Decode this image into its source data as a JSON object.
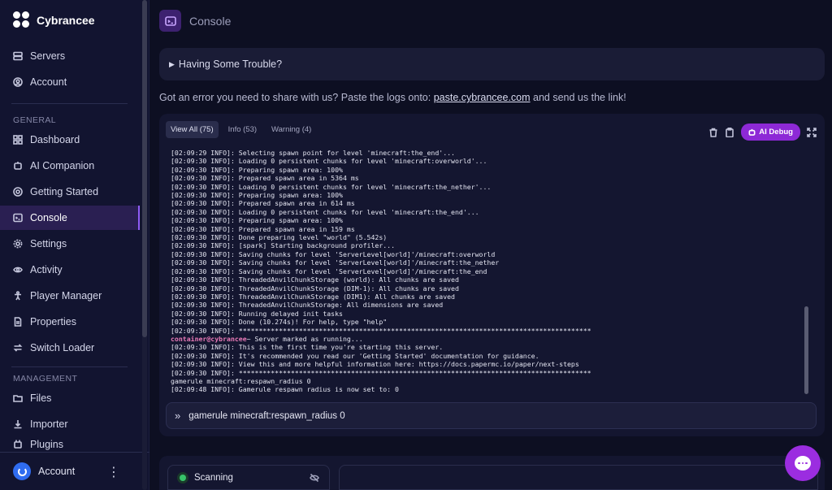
{
  "brand": {
    "name": "Cybrancee"
  },
  "sidebar": {
    "top_items": [
      {
        "label": "Servers",
        "icon": "servers-icon"
      },
      {
        "label": "Account",
        "icon": "account-icon"
      }
    ],
    "general_label": "GENERAL",
    "general_items": [
      {
        "label": "Dashboard",
        "icon": "dashboard-icon"
      },
      {
        "label": "AI Companion",
        "icon": "ai-companion-icon"
      },
      {
        "label": "Getting Started",
        "icon": "lifebuoy-icon"
      },
      {
        "label": "Console",
        "icon": "terminal-icon",
        "active": true
      },
      {
        "label": "Settings",
        "icon": "gear-icon"
      },
      {
        "label": "Activity",
        "icon": "eye-icon"
      },
      {
        "label": "Player Manager",
        "icon": "person-icon"
      },
      {
        "label": "Properties",
        "icon": "document-icon"
      },
      {
        "label": "Switch Loader",
        "icon": "swap-icon"
      }
    ],
    "management_label": "MANAGEMENT",
    "management_items": [
      {
        "label": "Files",
        "icon": "folder-icon"
      },
      {
        "label": "Importer",
        "icon": "download-icon"
      },
      {
        "label": "Plugins",
        "icon": "plugin-icon"
      }
    ],
    "account_label": "Account"
  },
  "header": {
    "title": "Console"
  },
  "trouble": {
    "label": "Having Some Trouble?"
  },
  "share": {
    "prefix": "Got an error you need to share with us? Paste the logs onto:",
    "link": "paste.cybrancee.com",
    "suffix": "and send us the link!"
  },
  "console": {
    "tabs": [
      "View All (75)",
      "Info (53)",
      "Warning (4)"
    ],
    "ai_debug_label": "AI Debug",
    "lines": [
      "[02:09:29 INFO]: Selecting spawn point for level 'minecraft:the_end'...",
      "[02:09:30 INFO]: Loading 0 persistent chunks for level 'minecraft:overworld'...",
      "[02:09:30 INFO]: Preparing spawn area: 100%",
      "[02:09:30 INFO]: Prepared spawn area in 5364 ms",
      "[02:09:30 INFO]: Loading 0 persistent chunks for level 'minecraft:the_nether'...",
      "[02:09:30 INFO]: Preparing spawn area: 100%",
      "[02:09:30 INFO]: Prepared spawn area in 614 ms",
      "[02:09:30 INFO]: Loading 0 persistent chunks for level 'minecraft:the_end'...",
      "[02:09:30 INFO]: Preparing spawn area: 100%",
      "[02:09:30 INFO]: Prepared spawn area in 159 ms",
      "[02:09:30 INFO]: Done preparing level \"world\" (5.542s)",
      "[02:09:30 INFO]: [spark] Starting background profiler...",
      "[02:09:30 INFO]: Saving chunks for level 'ServerLevel[world]'/minecraft:overworld",
      "[02:09:30 INFO]: Saving chunks for level 'ServerLevel[world]'/minecraft:the_nether",
      "[02:09:30 INFO]: Saving chunks for level 'ServerLevel[world]'/minecraft:the_end",
      "[02:09:30 INFO]: ThreadedAnvilChunkStorage (world): All chunks are saved",
      "[02:09:30 INFO]: ThreadedAnvilChunkStorage (DIM-1): All chunks are saved",
      "[02:09:30 INFO]: ThreadedAnvilChunkStorage (DIM1): All chunks are saved",
      "[02:09:30 INFO]: ThreadedAnvilChunkStorage: All dimensions are saved",
      "[02:09:30 INFO]: Running delayed init tasks",
      "[02:09:30 INFO]: Done (10.274s)! For help, type \"help\"",
      "[02:09:30 INFO]: ****************************************************************************************",
      "PROMPT",
      "[02:09:30 INFO]: This is the first time you're starting this server.",
      "[02:09:30 INFO]: It's recommended you read our 'Getting Started' documentation for guidance.",
      "[02:09:30 INFO]: View this and more helpful information here: https://docs.papermc.io/paper/next-steps",
      "[02:09:30 INFO]: ****************************************************************************************",
      "gamerule minecraft:respawn_radius 0",
      "[02:09:48 INFO]: Gamerule respawn_radius is now set to: 0"
    ],
    "prompt_user": "container@cybrancee",
    "prompt_text": "~ Server marked as running...",
    "command_value": "gamerule minecraft:respawn_radius 0",
    "command_chevron": "»"
  },
  "status_card": {
    "label": "Scanning"
  }
}
